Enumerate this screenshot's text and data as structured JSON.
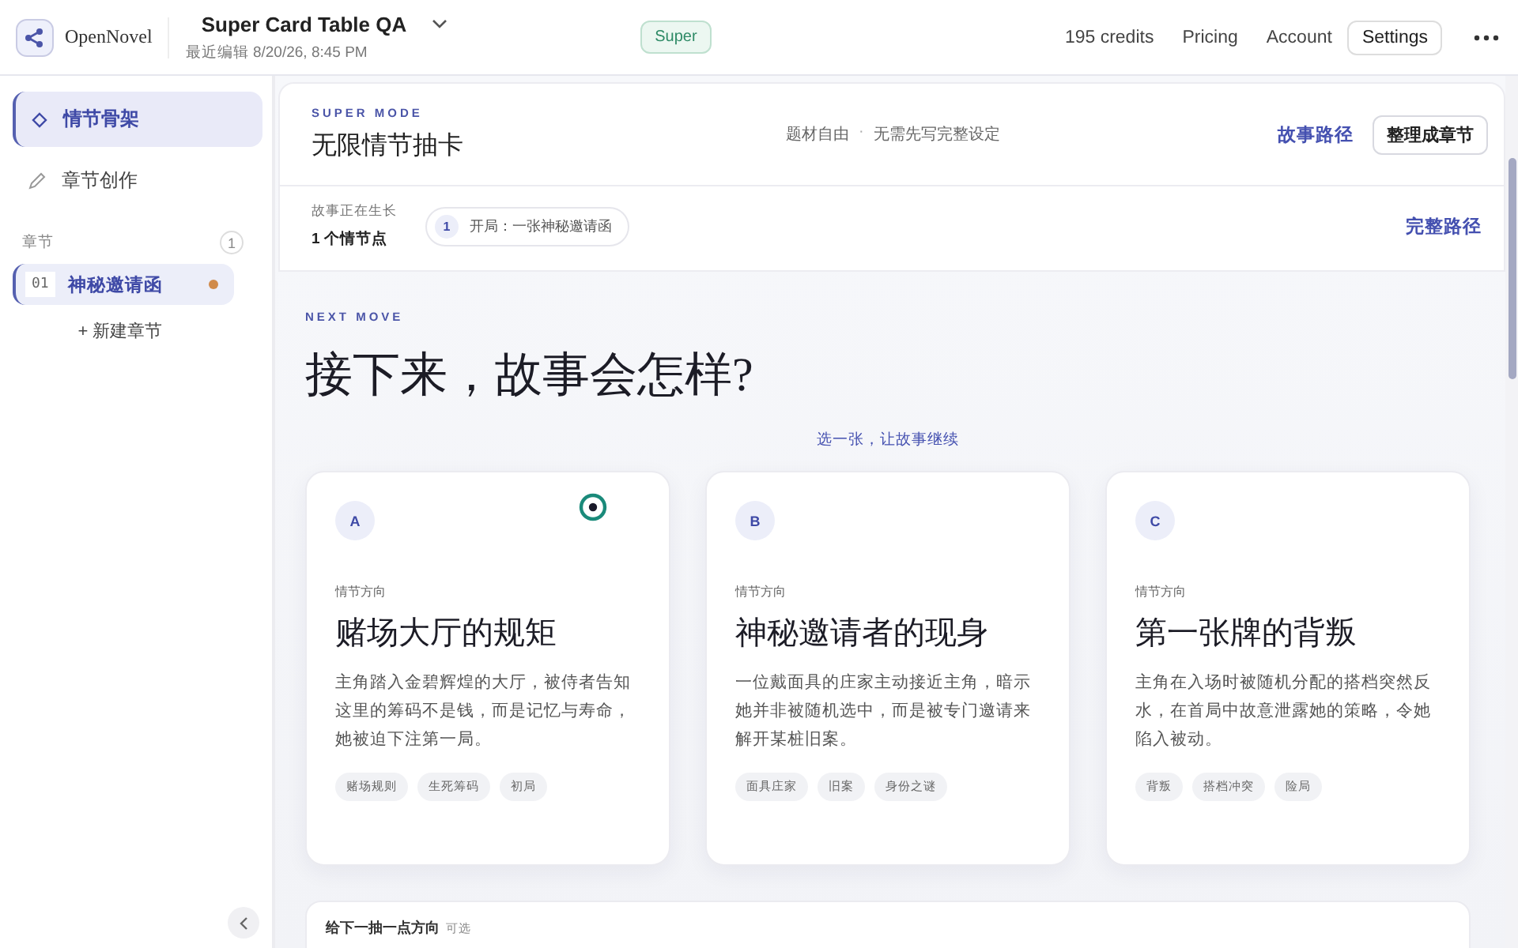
{
  "app": {
    "name": "OpenNovel"
  },
  "project": {
    "title": "Super Card Table QA",
    "edited": "最近编辑 8/20/26, 8:45 PM"
  },
  "plan_badge": "Super",
  "top_nav": {
    "credits": "195 credits",
    "links": [
      "Pricing",
      "Account"
    ],
    "settings": "Settings"
  },
  "sidebar": {
    "items": [
      {
        "label": "情节骨架",
        "selected": true
      },
      {
        "label": "章节创作",
        "selected": false
      }
    ],
    "section": {
      "label": "章节",
      "count": "1"
    },
    "chapters": [
      {
        "number": "01",
        "title": "神秘邀请函",
        "selected": true,
        "color": "#d08a4a"
      }
    ],
    "new_chapter": "+ 新建章节"
  },
  "mode": {
    "eyebrow": "SUPER MODE",
    "title": "无限情节抽卡",
    "tags": [
      "题材自由",
      "无需先写完整设定"
    ],
    "separator": "·",
    "path_link": "故事路径",
    "organize_button": "整理成章节"
  },
  "progress": {
    "label": "故事正在生长",
    "count": "1 个情节点",
    "nodes": [
      {
        "number": "1",
        "text": "开局：一张神秘邀请函"
      }
    ],
    "full_path": "完整路径"
  },
  "next": {
    "eyebrow": "NEXT MOVE",
    "title": "接下来，故事会怎样?",
    "hint": "选一张，让故事继续",
    "cards": [
      {
        "letter": "A",
        "kicker": "情节方向",
        "title": "赌场大厅的规矩",
        "body": "主角踏入金碧辉煌的大厅，被侍者告知这里的筹码不是钱，而是记忆与寿命，她被迫下注第一局。",
        "tags": [
          "赌场规则",
          "生死筹码",
          "初局"
        ]
      },
      {
        "letter": "B",
        "kicker": "情节方向",
        "title": "神秘邀请者的现身",
        "body": "一位戴面具的庄家主动接近主角，暗示她并非被随机选中，而是被专门邀请来解开某桩旧案。",
        "tags": [
          "面具庄家",
          "旧案",
          "身份之谜"
        ]
      },
      {
        "letter": "C",
        "kicker": "情节方向",
        "title": "第一张牌的背叛",
        "body": "主角在入场时被随机分配的搭档突然反水，在首局中故意泄露她的策略，令她陷入被动。",
        "tags": [
          "背叛",
          "搭档冲突",
          "险局"
        ]
      }
    ]
  },
  "direction": {
    "label": "给下一抽一点方向",
    "optional": "可选"
  }
}
